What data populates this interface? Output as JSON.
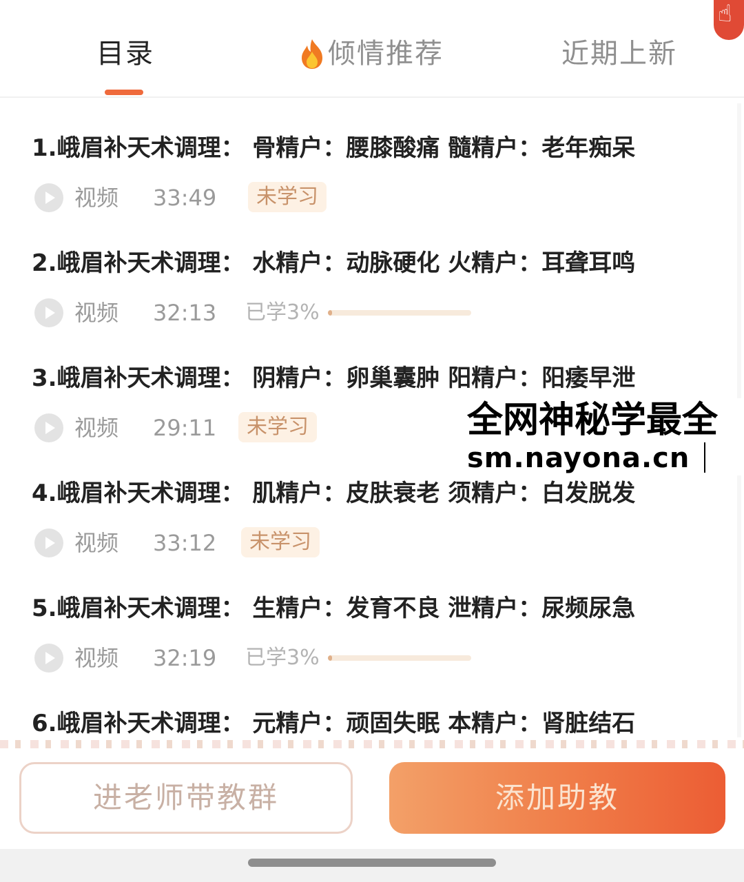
{
  "tabs": [
    {
      "label": "目录",
      "active": true
    },
    {
      "label": "倾情推荐",
      "icon": "flame-icon"
    },
    {
      "label": "近期上新"
    }
  ],
  "float_badge": {
    "icon": "hand-pointer-icon",
    "glyph": "☝"
  },
  "lessons": [
    {
      "title": "1.峨眉补天术调理： 骨精户：腰膝酸痛 髓精户：老年痴呆",
      "type": "视频",
      "duration": "33:49",
      "status": "未学习"
    },
    {
      "title": "2.峨眉补天术调理： 水精户：动脉硬化 火精户：耳聋耳鸣",
      "type": "视频",
      "duration": "32:13",
      "progress_text": "已学3%",
      "progress": 0.03
    },
    {
      "title": "3.峨眉补天术调理： 阴精户：卵巢囊肿 阳精户：阳痿早泄",
      "type": "视频",
      "duration": "29:11",
      "status": "未学习"
    },
    {
      "title": "4.峨眉补天术调理： 肌精户：皮肤衰老 须精户：白发脱发",
      "type": "视频",
      "duration": "33:12",
      "status": "未学习"
    },
    {
      "title": "5.峨眉补天术调理： 生精户：发育不良 泄精户：尿频尿急",
      "type": "视频",
      "duration": "32:19",
      "progress_text": "已学3%",
      "progress": 0.03
    },
    {
      "title": "6.峨眉补天术调理： 元精户：顽固失眠 本精户：肾脏结石"
    }
  ],
  "watermark": {
    "line1": "全网神秘学最全",
    "line2": "sm.nayona.cn"
  },
  "buttons": {
    "join_group": "进老师带教群",
    "add_assistant": "添加助教"
  },
  "colors": {
    "accent": "#ef6a3c",
    "button_gradient_start": "#f3a068",
    "button_gradient_end": "#ec5d34",
    "pill_bg": "#fdf1e4",
    "pill_text": "#c8926a"
  }
}
